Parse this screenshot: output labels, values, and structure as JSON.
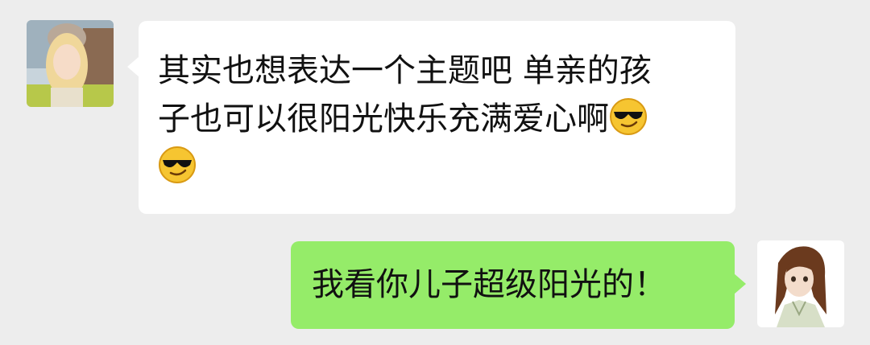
{
  "messages": [
    {
      "direction": "incoming",
      "text_line1": "其实也想表达一个主题吧 单亲的孩",
      "text_line2": "子也可以很阳光快乐充满爱心啊",
      "emojis": [
        "cool-sunglasses-emoji",
        "cool-sunglasses-emoji"
      ],
      "avatar": "woman-with-beanie-avatar",
      "bubble_color": "#ffffff"
    },
    {
      "direction": "outgoing",
      "text": "我看你儿子超级阳光的！",
      "avatar": "anime-long-hair-avatar",
      "bubble_color": "#95ec69"
    }
  ],
  "background_color": "#ededed"
}
